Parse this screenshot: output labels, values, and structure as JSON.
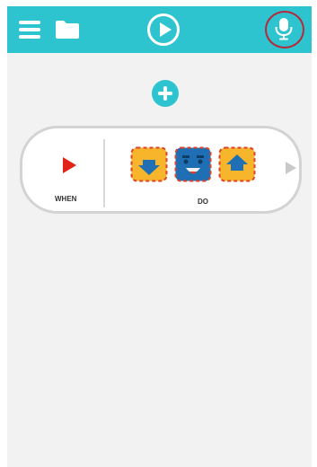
{
  "colors": {
    "accent": "#2ec4cf",
    "play_red": "#e2231a",
    "tile_yellow": "#f7b52b",
    "tile_blue": "#1f6fb4",
    "mic_highlight": "#b52a3a"
  },
  "icons": {
    "menu": "hamburger-menu",
    "folder": "folder",
    "play": "play-circle",
    "mic": "microphone",
    "add": "plus-circle"
  },
  "rule": {
    "when_label": "WHEN",
    "do_label": "DO",
    "do_blocks": [
      "move-down-block",
      "face-block",
      "move-up-block"
    ]
  }
}
